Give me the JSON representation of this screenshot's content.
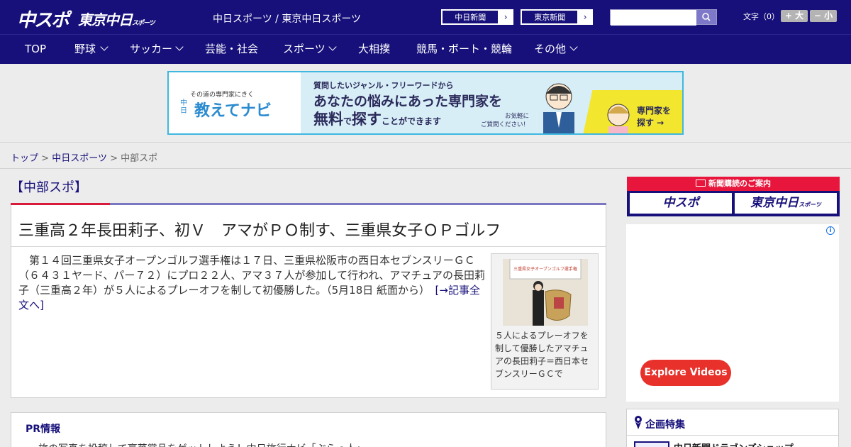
{
  "header": {
    "logo_chunichi": "中スポ",
    "logo_tokyo": "東京中日",
    "logo_tokyo_small": "スポーツ",
    "site_title": "中日スポーツ / 東京中日スポーツ",
    "btn_chunichi": "中日新聞",
    "btn_tokyo": "東京新聞",
    "btn_arrow": "›",
    "search_placeholder": "",
    "font_size_label": "文字（0）",
    "font_bigger": "+ 大",
    "font_smaller": "− 小"
  },
  "nav": {
    "items": [
      {
        "label": "TOP"
      },
      {
        "label": "野球"
      },
      {
        "label": "サッカー"
      },
      {
        "label": "芸能・社会"
      },
      {
        "label": "スポーツ"
      },
      {
        "label": "大相撲"
      },
      {
        "label": "競馬・ボート・競輪"
      },
      {
        "label": "その他"
      }
    ]
  },
  "banner": {
    "brand_small": "その道の専門家にきく",
    "brand_side": "中日",
    "brand_big": "教えてナビ",
    "line1": "質問したいジャンル・フリーワードから",
    "line2": "あなたの悩みにあった専門家を",
    "line3_a": "無料",
    "line3_b": "で",
    "line3_c": "探す",
    "line3_d": "ことができます",
    "note1": "お気軽に",
    "note2": "ご質問ください！",
    "cta1": "専門家を",
    "cta2": "探す →"
  },
  "breadcrumb": {
    "top": "トップ",
    "sep": ">",
    "section": "中日スポーツ",
    "current": "中部スポ"
  },
  "article": {
    "section_title": "【中部スポ】",
    "headline": "三重高２年長田莉子、初Ｖ　アマがＰＯ制す、三重県女子ＯＰゴルフ",
    "body": "　第１４回三重県女子オープンゴルフ選手権は１７日、三重県松阪市の西日本セブンスリーＧＣ（６４３１ヤード、パー７２）にプロ２２人、アマ３７人が参加して行われ、アマチュアの長田莉子（三重高２年）が５人によるプレーオフを制して初優勝した。（5月18日 紙面から）",
    "more_link": "[→記事全文へ]",
    "photo_banner_text": "三重県女子オープンゴルフ選手権",
    "caption": "５人によるプレーオフを制して優勝したアマチュアの長田莉子＝西日本セブンスリーＧＣで"
  },
  "pr": {
    "title": "PR情報",
    "item1": "・旅の写真を投稿して豪華賞品をゲットしよう！中日旅行ナビ「ぶらっ人」"
  },
  "sidebar": {
    "subscribe_head": "新聞購読のご案内",
    "sub_chunichi": "中スポ",
    "sub_tokyo": "東京中日",
    "sub_tokyo_small": "スポーツ",
    "ad_info": "i",
    "explore_label": "Explore Videos",
    "feature_title": "企画特集",
    "feature_item": "中日新聞ドラゴンズショップ"
  },
  "colors": {
    "brand_navy": "#17107a",
    "accent_red": "#d81b3a",
    "explore_red": "#e8312a"
  }
}
